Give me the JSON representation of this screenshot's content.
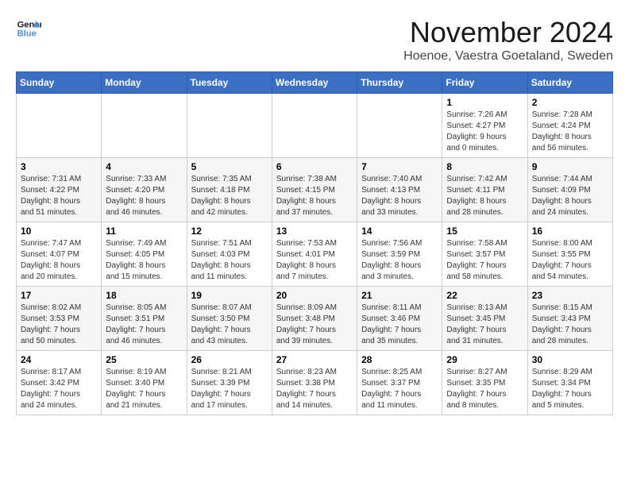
{
  "header": {
    "logo_line1": "General",
    "logo_line2": "Blue",
    "month_title": "November 2024",
    "location": "Hoenoe, Vaestra Goetaland, Sweden"
  },
  "weekdays": [
    "Sunday",
    "Monday",
    "Tuesday",
    "Wednesday",
    "Thursday",
    "Friday",
    "Saturday"
  ],
  "weeks": [
    [
      {
        "day": "",
        "sunrise": "",
        "sunset": "",
        "daylight": ""
      },
      {
        "day": "",
        "sunrise": "",
        "sunset": "",
        "daylight": ""
      },
      {
        "day": "",
        "sunrise": "",
        "sunset": "",
        "daylight": ""
      },
      {
        "day": "",
        "sunrise": "",
        "sunset": "",
        "daylight": ""
      },
      {
        "day": "",
        "sunrise": "",
        "sunset": "",
        "daylight": ""
      },
      {
        "day": "1",
        "sunrise": "7:26 AM",
        "sunset": "4:27 PM",
        "daylight": "9 hours and 0 minutes."
      },
      {
        "day": "2",
        "sunrise": "7:28 AM",
        "sunset": "4:24 PM",
        "daylight": "8 hours and 56 minutes."
      }
    ],
    [
      {
        "day": "3",
        "sunrise": "7:31 AM",
        "sunset": "4:22 PM",
        "daylight": "8 hours and 51 minutes."
      },
      {
        "day": "4",
        "sunrise": "7:33 AM",
        "sunset": "4:20 PM",
        "daylight": "8 hours and 46 minutes."
      },
      {
        "day": "5",
        "sunrise": "7:35 AM",
        "sunset": "4:18 PM",
        "daylight": "8 hours and 42 minutes."
      },
      {
        "day": "6",
        "sunrise": "7:38 AM",
        "sunset": "4:15 PM",
        "daylight": "8 hours and 37 minutes."
      },
      {
        "day": "7",
        "sunrise": "7:40 AM",
        "sunset": "4:13 PM",
        "daylight": "8 hours and 33 minutes."
      },
      {
        "day": "8",
        "sunrise": "7:42 AM",
        "sunset": "4:11 PM",
        "daylight": "8 hours and 28 minutes."
      },
      {
        "day": "9",
        "sunrise": "7:44 AM",
        "sunset": "4:09 PM",
        "daylight": "8 hours and 24 minutes."
      }
    ],
    [
      {
        "day": "10",
        "sunrise": "7:47 AM",
        "sunset": "4:07 PM",
        "daylight": "8 hours and 20 minutes."
      },
      {
        "day": "11",
        "sunrise": "7:49 AM",
        "sunset": "4:05 PM",
        "daylight": "8 hours and 15 minutes."
      },
      {
        "day": "12",
        "sunrise": "7:51 AM",
        "sunset": "4:03 PM",
        "daylight": "8 hours and 11 minutes."
      },
      {
        "day": "13",
        "sunrise": "7:53 AM",
        "sunset": "4:01 PM",
        "daylight": "8 hours and 7 minutes."
      },
      {
        "day": "14",
        "sunrise": "7:56 AM",
        "sunset": "3:59 PM",
        "daylight": "8 hours and 3 minutes."
      },
      {
        "day": "15",
        "sunrise": "7:58 AM",
        "sunset": "3:57 PM",
        "daylight": "7 hours and 58 minutes."
      },
      {
        "day": "16",
        "sunrise": "8:00 AM",
        "sunset": "3:55 PM",
        "daylight": "7 hours and 54 minutes."
      }
    ],
    [
      {
        "day": "17",
        "sunrise": "8:02 AM",
        "sunset": "3:53 PM",
        "daylight": "7 hours and 50 minutes."
      },
      {
        "day": "18",
        "sunrise": "8:05 AM",
        "sunset": "3:51 PM",
        "daylight": "7 hours and 46 minutes."
      },
      {
        "day": "19",
        "sunrise": "8:07 AM",
        "sunset": "3:50 PM",
        "daylight": "7 hours and 43 minutes."
      },
      {
        "day": "20",
        "sunrise": "8:09 AM",
        "sunset": "3:48 PM",
        "daylight": "7 hours and 39 minutes."
      },
      {
        "day": "21",
        "sunrise": "8:11 AM",
        "sunset": "3:46 PM",
        "daylight": "7 hours and 35 minutes."
      },
      {
        "day": "22",
        "sunrise": "8:13 AM",
        "sunset": "3:45 PM",
        "daylight": "7 hours and 31 minutes."
      },
      {
        "day": "23",
        "sunrise": "8:15 AM",
        "sunset": "3:43 PM",
        "daylight": "7 hours and 28 minutes."
      }
    ],
    [
      {
        "day": "24",
        "sunrise": "8:17 AM",
        "sunset": "3:42 PM",
        "daylight": "7 hours and 24 minutes."
      },
      {
        "day": "25",
        "sunrise": "8:19 AM",
        "sunset": "3:40 PM",
        "daylight": "7 hours and 21 minutes."
      },
      {
        "day": "26",
        "sunrise": "8:21 AM",
        "sunset": "3:39 PM",
        "daylight": "7 hours and 17 minutes."
      },
      {
        "day": "27",
        "sunrise": "8:23 AM",
        "sunset": "3:38 PM",
        "daylight": "7 hours and 14 minutes."
      },
      {
        "day": "28",
        "sunrise": "8:25 AM",
        "sunset": "3:37 PM",
        "daylight": "7 hours and 11 minutes."
      },
      {
        "day": "29",
        "sunrise": "8:27 AM",
        "sunset": "3:35 PM",
        "daylight": "7 hours and 8 minutes."
      },
      {
        "day": "30",
        "sunrise": "8:29 AM",
        "sunset": "3:34 PM",
        "daylight": "7 hours and 5 minutes."
      }
    ]
  ]
}
